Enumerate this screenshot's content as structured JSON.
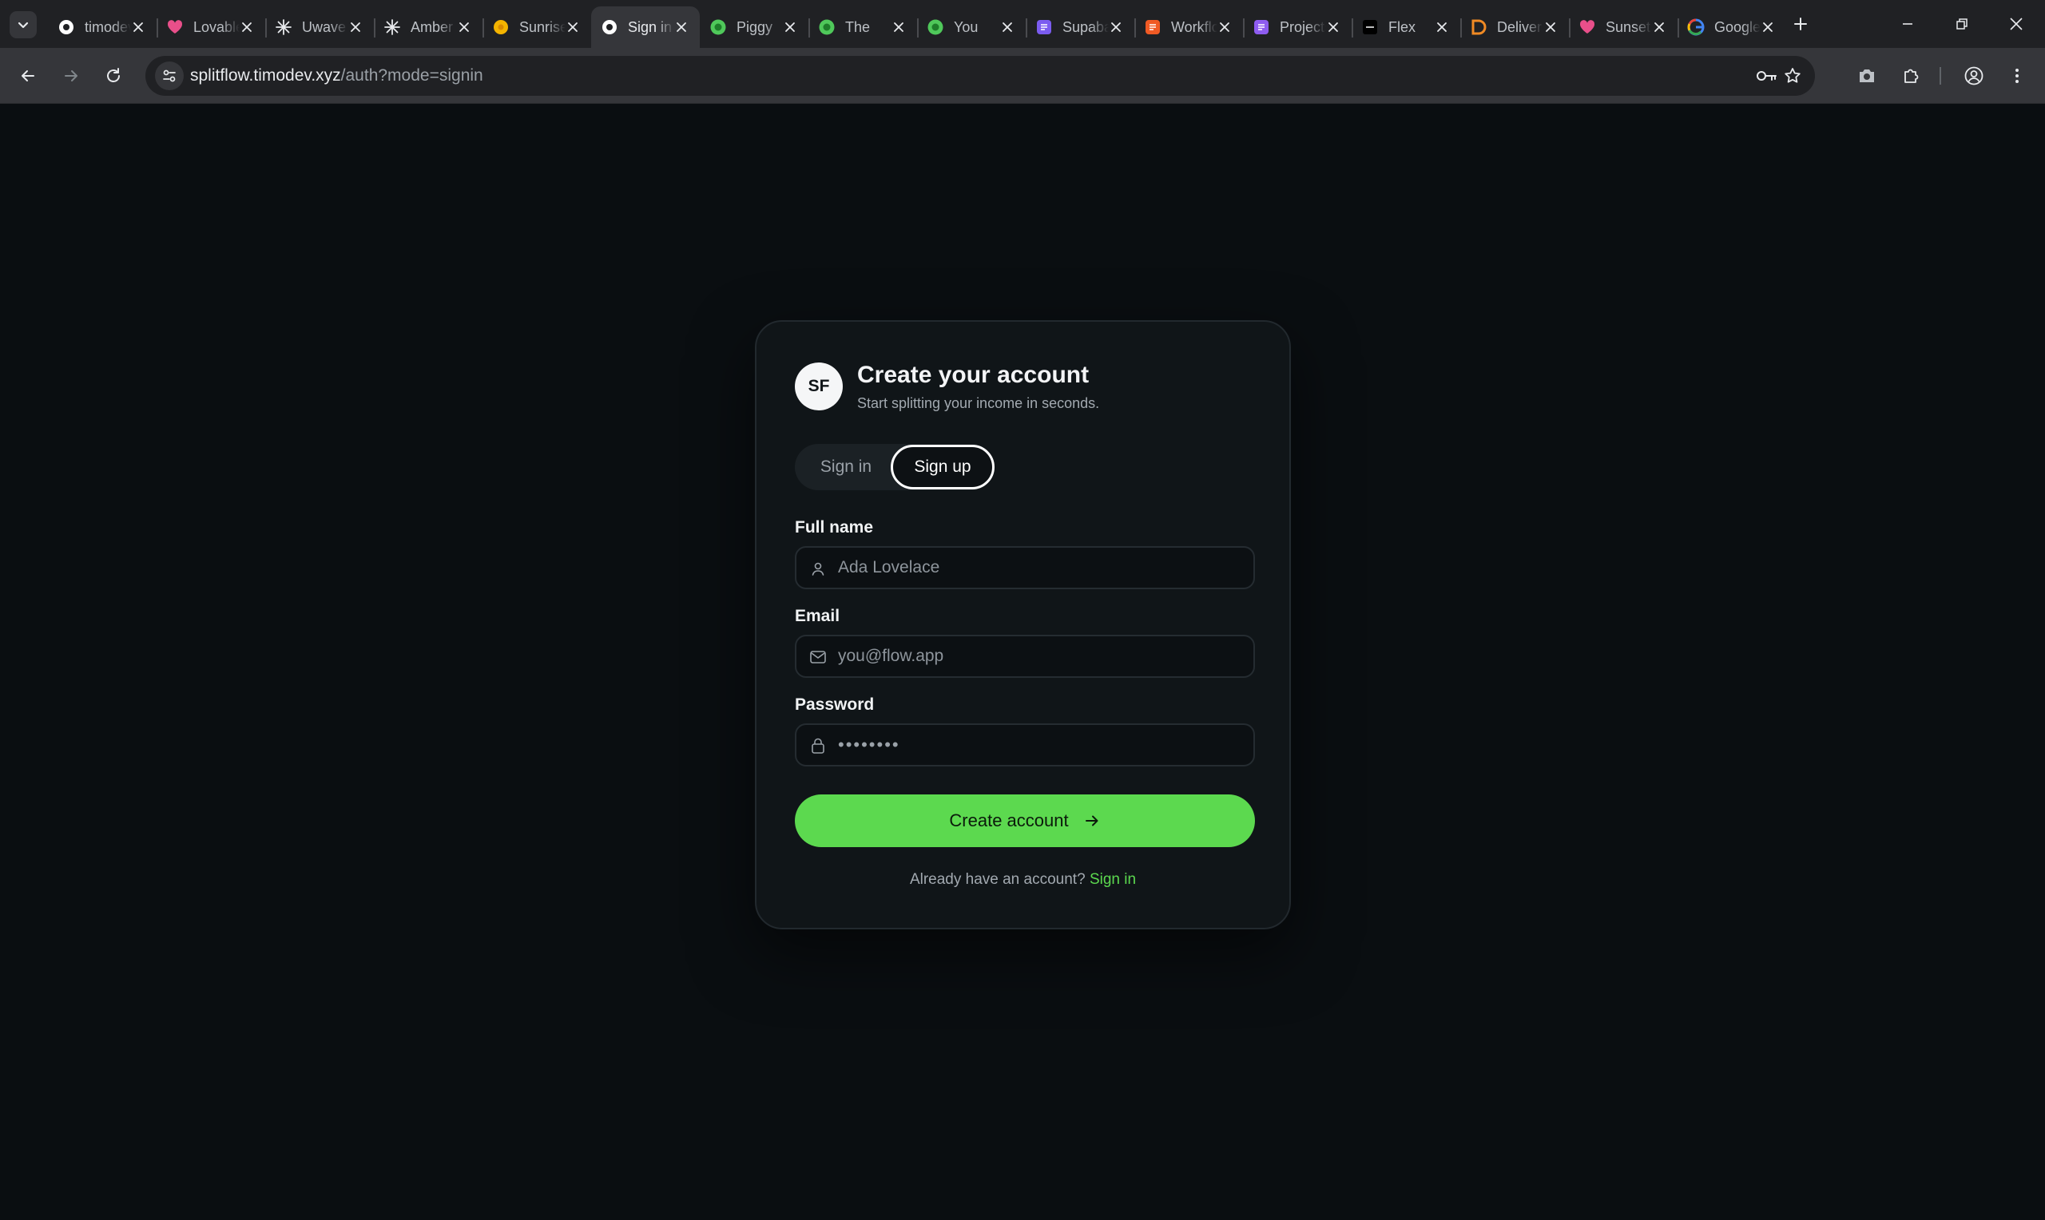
{
  "browser": {
    "tabs": [
      {
        "title": "timodev",
        "favicon_color": "#ffffff",
        "favicon_kind": "circle-dark"
      },
      {
        "title": "Lovable",
        "favicon_color": "#e94f8a",
        "favicon_kind": "heart"
      },
      {
        "title": "Uwave",
        "favicon_color": "#e8eaed",
        "favicon_kind": "spark"
      },
      {
        "title": "Amber",
        "favicon_color": "#e8eaed",
        "favicon_kind": "spark"
      },
      {
        "title": "Sunrise",
        "favicon_color": "#f4b400",
        "favicon_kind": "sun"
      },
      {
        "title": "Sign in",
        "favicon_color": "#ffffff",
        "favicon_kind": "circle-dark",
        "active": true
      },
      {
        "title": "Piggy",
        "favicon_color": "#4fc85a",
        "favicon_kind": "blob"
      },
      {
        "title": "The",
        "favicon_color": "#4fc85a",
        "favicon_kind": "blob"
      },
      {
        "title": "You",
        "favicon_color": "#4fc85a",
        "favicon_kind": "blob"
      },
      {
        "title": "Supabase",
        "favicon_color": "#7b5cf0",
        "favicon_kind": "square"
      },
      {
        "title": "Workflow",
        "favicon_color": "#f05a24",
        "favicon_kind": "square"
      },
      {
        "title": "Projects",
        "favicon_color": "#8e5cf0",
        "favicon_kind": "square"
      },
      {
        "title": "Flex",
        "favicon_color": "#000000",
        "favicon_kind": "square-dark"
      },
      {
        "title": "Deliver",
        "favicon_color": "#f08a24",
        "favicon_kind": "letter"
      },
      {
        "title": "Sunset",
        "favicon_color": "#e94f8a",
        "favicon_kind": "heart"
      },
      {
        "title": "Google",
        "favicon_color": "#4285f4",
        "favicon_kind": "google"
      }
    ],
    "url_host": "splitflow.timodev.xyz",
    "url_path": "/auth?mode=signin"
  },
  "auth": {
    "logo_text": "SF",
    "title": "Create your account",
    "subtitle": "Start splitting your income in seconds.",
    "toggle": {
      "signin_label": "Sign in",
      "signup_label": "Sign up",
      "selected": "signup"
    },
    "fields": {
      "name_label": "Full name",
      "name_placeholder": "Ada Lovelace",
      "email_label": "Email",
      "email_placeholder": "you@flow.app",
      "password_label": "Password",
      "password_value": "••••••••"
    },
    "submit_label": "Create account",
    "footer_text": "Already have an account?",
    "footer_link": "Sign in",
    "accent_color": "#5cd94f"
  }
}
